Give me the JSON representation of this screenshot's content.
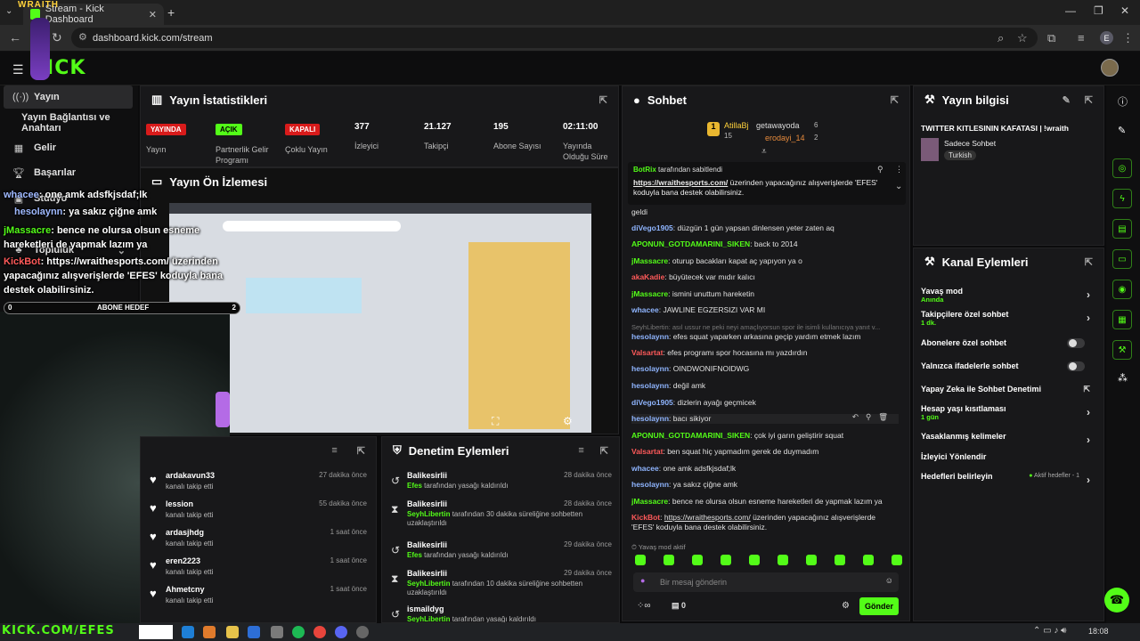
{
  "browser": {
    "tab_title": "Stream - Kick Dashboard",
    "url": "dashboard.kick.com/stream",
    "profile_initial": "E"
  },
  "brand": {
    "logo": "KICK",
    "accent": "#53fc18"
  },
  "overlay": {
    "wraith_tag": "WRAITH",
    "bottom_banner": "KICK.COM/EFES",
    "abone_count": "0",
    "abone_label": "ABONE HEDEF",
    "abone_max": "2",
    "lines": [
      {
        "user": "whacee",
        "text": ": one amk adsfkjsdaf;lk"
      },
      {
        "user": "hesolaynn",
        "text": ": ya sakız çiğne amk"
      },
      {
        "user": "jMassacre",
        "text": ": bence ne olursa olsun esneme hareketleri de yapmak lazım ya"
      },
      {
        "user": "KickBot",
        "text": ": https://wraithesports.com/ üzerinden yapacağınız alışverişlerde 'EFES' koduyla bana destek olabilirsiniz."
      }
    ]
  },
  "sidebar": {
    "items": [
      {
        "label": "Yayın",
        "icon": "broadcast-icon"
      },
      {
        "label": "Yayın Bağlantısı ve Anahtarı",
        "icon": ""
      },
      {
        "label": "Gelir",
        "icon": "money-icon"
      },
      {
        "label": "Başarılar",
        "icon": "trophy-icon"
      },
      {
        "label": "Stüdyo",
        "icon": "studio-icon"
      },
      {
        "label": "Topluluk",
        "icon": "community-icon"
      }
    ]
  },
  "stats": {
    "title": "Yayın İstatistikleri",
    "items": [
      {
        "value": "YAYINDA",
        "label": "Yayın",
        "kind": "red"
      },
      {
        "value": "AÇIK",
        "label": "Partnerlik Gelir Programı",
        "kind": "green"
      },
      {
        "value": "KAPALI",
        "label": "Çoklu Yayın",
        "kind": "red"
      },
      {
        "value": "377",
        "label": "İzleyici",
        "kind": "num"
      },
      {
        "value": "21.127",
        "label": "Takipçi",
        "kind": "num"
      },
      {
        "value": "195",
        "label": "Abone Sayısı",
        "kind": "num"
      },
      {
        "value": "02:11:00",
        "label": "Yayında Olduğu Süre",
        "kind": "num"
      }
    ]
  },
  "preview": {
    "title": "Yayın Ön İzlemesi"
  },
  "activity": {
    "rows": [
      {
        "name": "ardakavun33",
        "sub": "kanalı takip etti",
        "time": "27 dakika önce"
      },
      {
        "name": "lession",
        "sub": "kanalı takip etti",
        "time": "55 dakika önce"
      },
      {
        "name": "ardasjhdg",
        "sub": "kanalı takip etti",
        "time": "1 saat önce"
      },
      {
        "name": "eren2223",
        "sub": "kanalı takip etti",
        "time": "1 saat önce"
      },
      {
        "name": "Ahmetcny",
        "sub": "kanalı takip etti",
        "time": "1 saat önce"
      }
    ]
  },
  "moderation": {
    "title": "Denetim Eylemleri",
    "rows": [
      {
        "name": "Balikesirlii",
        "actor": "Efes",
        "sub": "tarafından yasağı kaldırıldı",
        "time": "28 dakika önce",
        "icon": "undo-icon"
      },
      {
        "name": "Balikesirlii",
        "actor": "SeyhLibertin",
        "sub": "tarafından 30 dakika süreliğine sohbetten uzaklaştırıldı",
        "time": "28 dakika önce",
        "icon": "hourglass-icon"
      },
      {
        "name": "Balikesirlii",
        "actor": "Efes",
        "sub": "tarafından yasağı kaldırıldı",
        "time": "29 dakika önce",
        "icon": "undo-icon"
      },
      {
        "name": "Balikesirlii",
        "actor": "SeyhLibertin",
        "sub": "tarafından 10 dakika süreliğine sohbetten uzaklaştırıldı",
        "time": "29 dakika önce",
        "icon": "hourglass-icon"
      },
      {
        "name": "ismaildyg",
        "actor": "SeyhLibertin",
        "sub": "tarafından yasağı kaldırıldı",
        "time": "",
        "icon": "undo-icon"
      }
    ]
  },
  "chat": {
    "title": "Sohbet",
    "leaders": [
      {
        "name": "AtillaBj",
        "count": "15"
      },
      {
        "name": "getawayoda",
        "count": "6"
      },
      {
        "name": "erodayi_14",
        "count": "2"
      }
    ],
    "pinned_by": "BotRix",
    "pinned_by_suffix": "tarafından sabitlendi",
    "pinned_link": "https://wraithesports.com/",
    "pinned_text": " üzerinden yapacağınız alışverişlerde 'EFES' koduyla bana destek olabilirsiniz.",
    "messages": [
      {
        "user": "",
        "text": "geldi",
        "color": "ucw"
      },
      {
        "user": "diVego1905",
        "text": "düzgün 1 gün yapsan dinlensen yeter zaten aq",
        "color": "ucb"
      },
      {
        "user": "APONUN_GOTDAMARINI_SIKEN",
        "text": "back to 2014",
        "color": "ucg"
      },
      {
        "user": "jMassacre",
        "text": "oturup bacakları kapat aç yapıyon ya o",
        "color": "ucg"
      },
      {
        "user": "akaKadie",
        "text": "büyütecek var mıdır kalıcı",
        "color": "ucr"
      },
      {
        "user": "jMassacre",
        "text": "ismini unuttum hareketin",
        "color": "ucg"
      },
      {
        "user": "whacee",
        "text": "JAWLINE EGZERSIZI VAR MI",
        "color": "ucb"
      },
      {
        "user": "SeyhLibertin",
        "text": "asıl ussur ne peki neyi amaçlıyorsun spor ile isimli kullanıcıya yanıt v...",
        "color": "ucw"
      },
      {
        "user": "hesolaynn",
        "text": "efes squat yaparken arkasına geçip yardım etmek lazım",
        "color": "ucb"
      },
      {
        "user": "Valsartat",
        "text": "efes programı spor hocasına mı yazdırdın",
        "color": "ucr"
      },
      {
        "user": "hesolaynn",
        "text": "OINDWONIFNOIDWG",
        "color": "ucb"
      },
      {
        "user": "hesolaynn",
        "text": "değil amk",
        "color": "ucb"
      },
      {
        "user": "diVego1905",
        "text": "dizlerin ayağı geçmicek",
        "color": "ucb"
      },
      {
        "user": "hesolaynn",
        "text": "bacı sikiyor",
        "color": "ucb"
      },
      {
        "user": "APONUN_GOTDAMARINI_SIKEN",
        "text": "çok iyi garın geliştirir squat",
        "color": "ucg"
      },
      {
        "user": "Valsartat",
        "text": "ben squat hiç yapmadım gerek de duymadım",
        "color": "ucr"
      },
      {
        "user": "whacee",
        "text": "one amk adsfkjsdaf;lk",
        "color": "ucb"
      },
      {
        "user": "hesolaynn",
        "text": "ya sakız çiğne amk",
        "color": "ucb"
      },
      {
        "user": "jMassacre",
        "text": "bence ne olursa olsun esneme hareketleri de yapmak lazım ya",
        "color": "ucg"
      }
    ],
    "bot_user": "KickBot",
    "bot_link": "https://wraithesports.com/",
    "bot_text": " üzerinden yapacağınız alışverişlerde 'EFES' koduyla bana destek olabilirsiniz.",
    "slow_mode_notice": "Yavaş mod aktif",
    "input_placeholder": "Bir mesaj gönderin",
    "points": "0",
    "send_label": "Gönder"
  },
  "stream_info": {
    "title": "Yayın bilgisi",
    "stream_title": "TWITTER KITLESININ KAFATASI | !wraith",
    "category": "Sadece Sohbet",
    "tag": "Turkish"
  },
  "channel_actions": {
    "title": "Kanal Eylemleri",
    "rows": [
      {
        "label": "Yavaş mod",
        "sub": "Anında",
        "control": "arrow"
      },
      {
        "label": "Takipçilere özel sohbet",
        "sub": "1 dk.",
        "control": "arrow"
      },
      {
        "label": "Abonelere özel sohbet",
        "sub": "",
        "control": "toggle"
      },
      {
        "label": "Yalnızca ifadelerle sohbet",
        "sub": "",
        "control": "toggle"
      },
      {
        "label": "Yapay Zeka ile Sohbet Denetimi",
        "sub": "",
        "control": "external"
      },
      {
        "label": "Hesap yaşı kısıtlaması",
        "sub": "1 gün",
        "control": "arrow"
      },
      {
        "label": "Yasaklanmış kelimeler",
        "sub": "",
        "control": "arrow"
      },
      {
        "label": "İzleyici Yönlendir",
        "sub": "",
        "control": "none"
      },
      {
        "label": "Hedefleri belirleyin",
        "sub": "",
        "control": "goals"
      }
    ],
    "goals_status": "Aktif hedefler - 1"
  },
  "taskbar": {
    "time": "18:08"
  }
}
